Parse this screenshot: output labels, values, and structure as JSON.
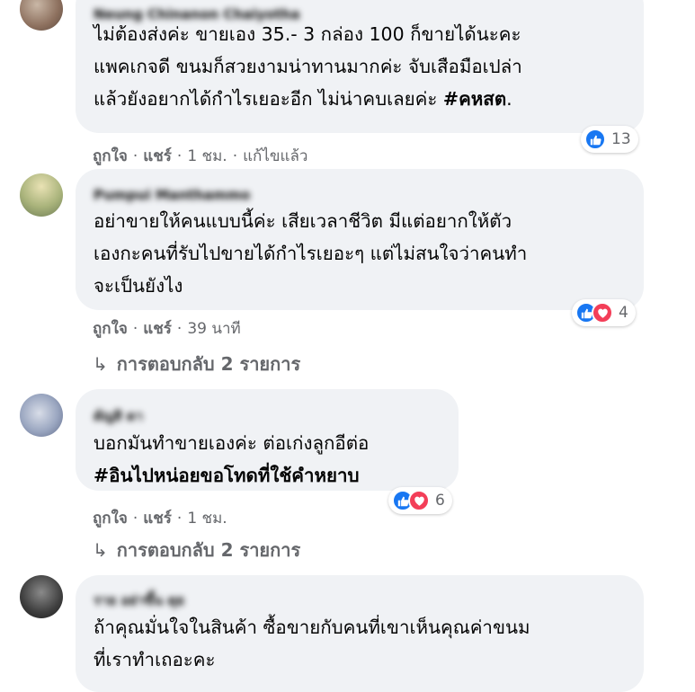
{
  "comments": [
    {
      "author": "Neung Chinanon Chaiyotha",
      "lines": [
        [
          {
            "t": "ไม่ต้องส่งค่ะ ขายเอง 35.- 3 กล่อง 100 ก็ขายได้นะคะ"
          }
        ],
        [
          {
            "t": "แพคเกจดี ขนมก็สวยงามน่าทานมากค่ะ จับเสือมือเปล่า"
          }
        ],
        [
          {
            "t": "แล้วยังอยากได้กำไรเยอะอีก ไม่น่าคบเลยค่ะ "
          },
          {
            "t": "#คหสต",
            "b": true
          },
          {
            "t": "."
          }
        ]
      ],
      "like_label": "ถูกใจ",
      "share_label": "แชร์",
      "time": "1 ชม.",
      "edited": "แก้ไขแล้ว",
      "reaction_count": "13",
      "reactions": [
        "like-icon"
      ]
    },
    {
      "author": "Pumpui Manthammo",
      "lines": [
        [
          {
            "t": "อย่าขายให้คนแบบนี้ค่ะ เสียเวลาชีวิต มีแต่อยากให้ตัว"
          }
        ],
        [
          {
            "t": "เองกะคนที่รับไปขายได้กำไรเยอะๆ แต่ไม่สนใจว่าคนทำ"
          }
        ],
        [
          {
            "t": "จะเป็นยังไง"
          }
        ]
      ],
      "like_label": "ถูกใจ",
      "share_label": "แชร์",
      "time": "39 นาที",
      "reaction_count": "4",
      "reactions": [
        "like-icon",
        "love-icon"
      ],
      "replies_label": "การตอบกลับ 2 รายการ"
    },
    {
      "author": "ดัญสิ ดา",
      "lines": [
        [
          {
            "t": "บอกมันทำขายเองค่ะ ต่อเก่งลูกอีต่อ"
          }
        ],
        [
          {
            "t": "#อินไปหน่อยขอโทดที่ใช้คำหยาบ",
            "b": true
          }
        ]
      ],
      "like_label": "ถูกใจ",
      "share_label": "แชร์",
      "time": "1 ชม.",
      "reaction_count": "6",
      "reactions": [
        "like-icon",
        "love-icon"
      ],
      "replies_label": "การตอบกลับ 2 รายการ"
    },
    {
      "author": "ราย อย่าขึ้น ดุย",
      "lines": [
        [
          {
            "t": "ถ้าคุณมั่นใจในสินค้า ซื้อขายกับคนที่เขาเห็นคุณค่าขนม"
          }
        ],
        [
          {
            "t": "ที่เราทำเถอะคะ"
          }
        ]
      ]
    }
  ],
  "colors": {
    "bubble": "#f0f2f5",
    "meta": "#65676b",
    "like": "#1877f2",
    "love": "#f33e58"
  }
}
